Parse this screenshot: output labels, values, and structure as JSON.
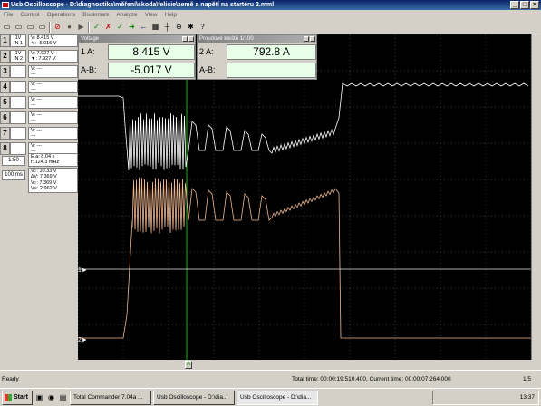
{
  "window": {
    "title": "Usb Oscilloscope - D:\\diagnostika\\měření\\skoda\\felicie\\země a napětí na startéru 2.mml",
    "buttons": [
      "_",
      "□",
      "×"
    ]
  },
  "menu": [
    "File",
    "Control",
    "Operations",
    "Bookmark",
    "Analyze",
    "View",
    "Help"
  ],
  "toolbar": {
    "icons": [
      "new-icon",
      "open-icon",
      "save-icon",
      "print-icon",
      "stop-icon",
      "record-icon",
      "play-icon",
      "check-icon",
      "cross-icon",
      "green-check-icon",
      "arrow-right-icon",
      "arrow-left-icon",
      "grid-icon",
      "cursor-icon",
      "zoom-icon",
      "settings-icon",
      "help-icon"
    ],
    "glyphs": [
      "▭",
      "▭",
      "▭",
      "▭",
      "⊘",
      "●",
      "▶",
      "✓",
      "✗",
      "✓",
      "➜",
      "←",
      "▦",
      "┼",
      "⊕",
      "✱",
      "?"
    ]
  },
  "channels": [
    {
      "num": "1",
      "box": [
        "1V",
        "IN 1"
      ],
      "vals": [
        "V: 8.415 V",
        "∿: -5.016 V"
      ]
    },
    {
      "num": "2",
      "box": [
        "1V",
        "IN 2"
      ],
      "vals": [
        "V: 7.927 V",
        "▼: 7.927 V"
      ]
    },
    {
      "num": "3",
      "box": [
        "",
        ""
      ],
      "vals": [
        "V: ---",
        "---"
      ]
    },
    {
      "num": "4",
      "box": [
        "",
        ""
      ],
      "vals": [
        "V: ---",
        "---"
      ]
    },
    {
      "num": "5",
      "box": [
        "",
        ""
      ],
      "vals": [
        "V: ---",
        "---"
      ]
    },
    {
      "num": "6",
      "box": [
        "",
        ""
      ],
      "vals": [
        "V: ---",
        "---"
      ]
    },
    {
      "num": "7",
      "box": [
        "",
        ""
      ],
      "vals": [
        "V: ---",
        "---"
      ]
    },
    {
      "num": "8",
      "box": [
        "",
        ""
      ],
      "vals": [
        "V: ---",
        "---"
      ]
    }
  ],
  "timebase": {
    "ratio": "1:50",
    "time": "100 ms"
  },
  "info": {
    "freq": [
      "Ε.a:  8.04 s",
      "f: 124.3 mHz"
    ],
    "volts": [
      "V↕: 10.33 V",
      "∆V: 7.369 V",
      "V↕: 7.369 V",
      "V≡: 2.962 V"
    ]
  },
  "meters": {
    "voltage": {
      "title": "Voltage",
      "ch": "1",
      "a_label": "A:",
      "a_value": "8.415 V",
      "ab_label": "A-B:",
      "ab_value": "-5.017 V"
    },
    "current": {
      "title": "Proudové kleště 1/100",
      "ch": "2",
      "a_label": "A:",
      "a_value": "792.8 A",
      "ab_label": "A-B:",
      "ab_value": ""
    }
  },
  "markers": {
    "ch1": "1►",
    "ch2": "2►",
    "cursor": "A"
  },
  "status": {
    "left": "Ready",
    "total": "Total time: 00:00:19:510.400, Current time: 00:00:07:264.000",
    "page": "1/5"
  },
  "taskbar": {
    "start": "Start",
    "tasks": [
      "Total Commander 7.04a ...",
      "Usb Oscilloscope - D:\\dia...",
      "Usb Oscilloscope - D:\\dia..."
    ],
    "clock": "13:37"
  },
  "colors": {
    "trace1": "#ffffff",
    "trace2": "#f0b890",
    "grid": "#3c3c3c",
    "cursor": "#00c000"
  }
}
